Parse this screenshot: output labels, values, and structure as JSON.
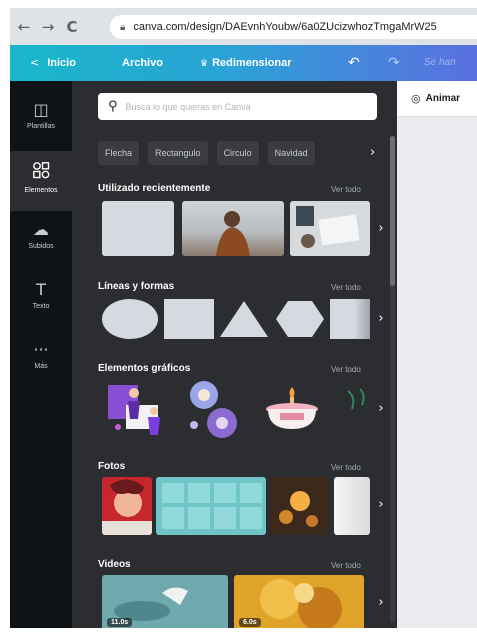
{
  "browser": {
    "back_icon": "arrow-left-icon",
    "forward_icon": "arrow-right-icon",
    "reload_icon": "reload-icon",
    "url": "canva.com/design/DAEvnhYoubw/6a0ZUcizwhozTmgaMrW25"
  },
  "topbar": {
    "home_label": "Inicio",
    "file_label": "Archivo",
    "resize_label": "Redimensionar",
    "saved_label": "Se han"
  },
  "rail": {
    "items": [
      {
        "label": "Plantillas",
        "icon": "templates-icon"
      },
      {
        "label": "Elementos",
        "icon": "elements-icon"
      },
      {
        "label": "Subidos",
        "icon": "upload-icon"
      },
      {
        "label": "Texto",
        "icon": "text-icon"
      },
      {
        "label": "Más",
        "icon": "more-icon"
      }
    ],
    "active": "Elementos"
  },
  "panel": {
    "search_placeholder": "Busca lo que quieras en Canva",
    "chips": [
      "Flecha",
      "Rectangulo",
      "Circulo",
      "Navidad"
    ],
    "see_all_label": "Ver todo",
    "sections": {
      "recent": {
        "title": "Utilizado recientemente"
      },
      "shapes": {
        "title": "Líneas y formas"
      },
      "graphics": {
        "title": "Elementos gráficos"
      },
      "photos": {
        "title": "Fotos"
      },
      "videos": {
        "title": "Videos",
        "durations": [
          "11.0s",
          "6.0s"
        ]
      }
    }
  },
  "canvas": {
    "animate_label": "Animar"
  },
  "colors": {
    "panel_bg": "#2b2d31",
    "rail_bg": "#0e1318",
    "topbar_start": "#19b7c9",
    "topbar_end": "#5b6fe0",
    "shape_fill": "#d6dae0"
  }
}
